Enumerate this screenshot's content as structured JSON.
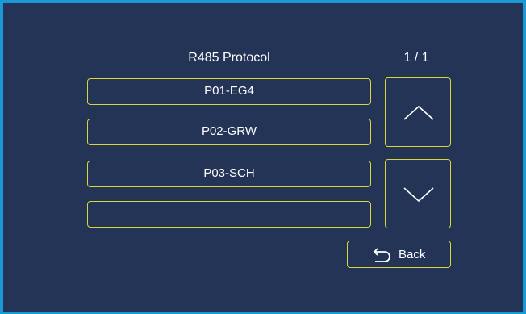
{
  "screen": {
    "title": "R485 Protocol",
    "page_indicator": "1 / 1"
  },
  "protocol_list": {
    "items": [
      {
        "label": "P01-EG4"
      },
      {
        "label": "P02-GRW"
      },
      {
        "label": "P03-SCH"
      },
      {
        "label": ""
      }
    ]
  },
  "navigation": {
    "up_icon": "chevron-up-icon",
    "down_icon": "chevron-down-icon",
    "back_icon": "back-arrow-icon",
    "back_label": "Back"
  },
  "colors": {
    "background": "#233456",
    "frame_border": "#1b99d6",
    "button_border": "#d9d63c",
    "text": "#ffffff"
  }
}
